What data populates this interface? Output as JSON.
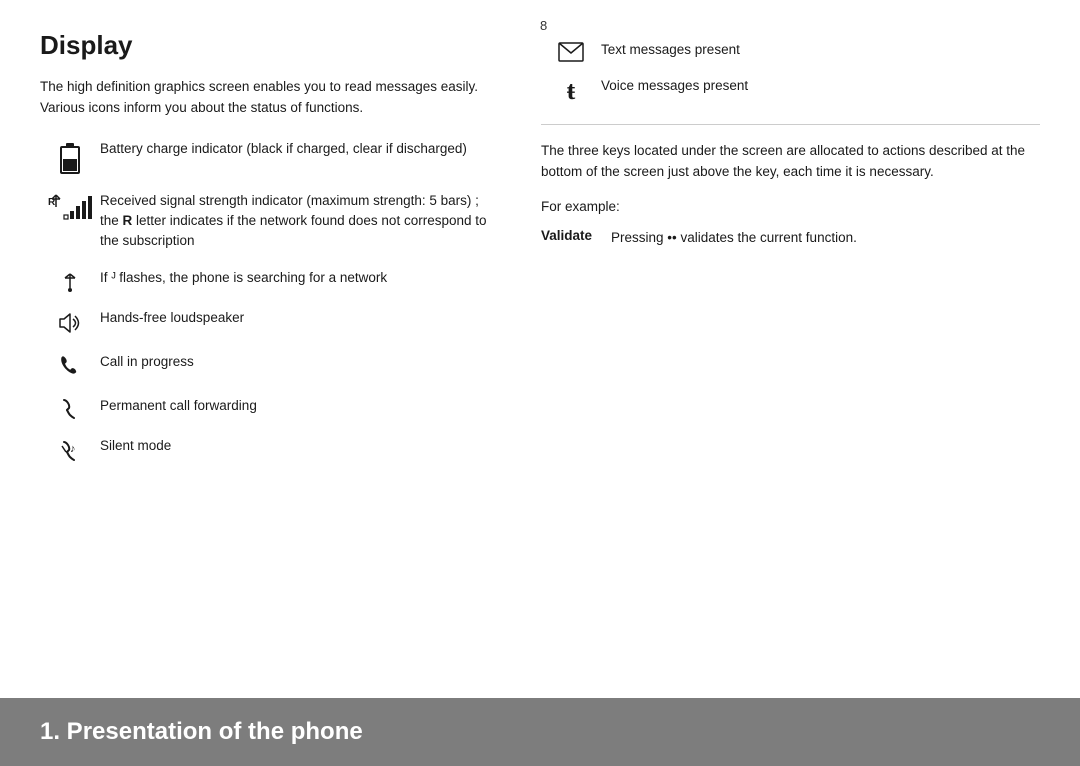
{
  "page": {
    "number": "8",
    "background_color": "#ffffff"
  },
  "left_column": {
    "title": "Display",
    "intro": "The high definition graphics screen enables you to read messages easily. Various icons inform you about the status of functions.",
    "icon_rows": [
      {
        "icon_type": "battery",
        "text": "Battery charge indicator (black if charged, clear if discharged)"
      },
      {
        "icon_type": "signal",
        "text": "Received signal strength indicator (maximum strength: 5 bars) ; the R letter indicates if the network found does not correspond to the subscription"
      },
      {
        "icon_type": "signal_flash",
        "text": "If Ȳ flashes, the phone is searching for a network"
      },
      {
        "icon_type": "handsfree",
        "text": "Hands-free loudspeaker"
      },
      {
        "icon_type": "call",
        "text": "Call in progress"
      },
      {
        "icon_type": "forward",
        "text": "Permanent call forwarding"
      },
      {
        "icon_type": "silent",
        "text": "Silent mode"
      }
    ]
  },
  "right_column": {
    "icon_rows": [
      {
        "icon_type": "envelope",
        "text": "Text messages present"
      },
      {
        "icon_type": "voicemail",
        "text": "Voice messages present"
      }
    ],
    "body_text": "The three keys located under the screen are allocated to actions described at the bottom of the screen just above the key, each time it is necessary.",
    "for_example": "For example:",
    "validate": {
      "label": "Validate",
      "text": "Pressing •• validates the current function."
    }
  },
  "footer": {
    "title": "1. Presentation of the phone",
    "background_color": "#7d7d7d"
  }
}
